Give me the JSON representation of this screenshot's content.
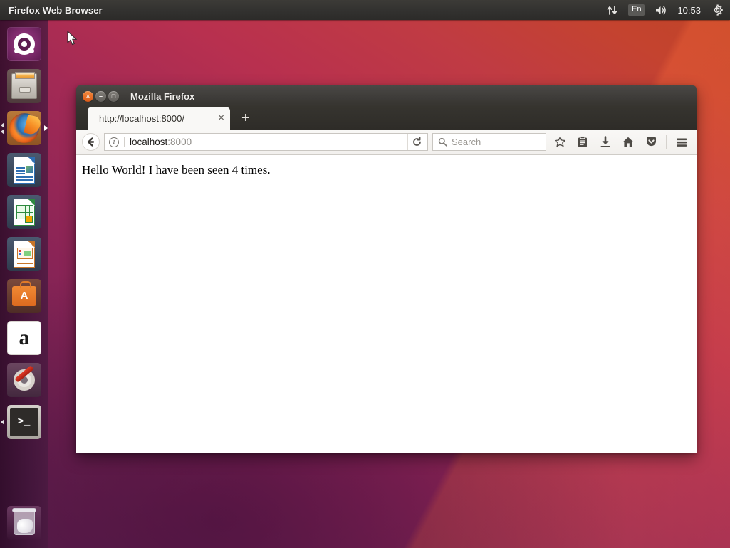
{
  "panel": {
    "title": "Firefox Web Browser",
    "indicators": {
      "network_icon": "network-transfer-icon",
      "keyboard_layout": "En",
      "volume_icon": "volume-speaker-icon",
      "clock": "10:53",
      "session_icon": "session-gear-icon"
    }
  },
  "launcher": {
    "items": [
      {
        "name": "ubuntu-dash",
        "label": "Ubuntu Dash",
        "running": false,
        "focused": false
      },
      {
        "name": "files",
        "label": "Files",
        "running": false,
        "focused": false
      },
      {
        "name": "firefox",
        "label": "Firefox Web Browser",
        "running": true,
        "focused": true
      },
      {
        "name": "libreoffice-writer",
        "label": "LibreOffice Writer",
        "running": false,
        "focused": false
      },
      {
        "name": "libreoffice-calc",
        "label": "LibreOffice Calc",
        "running": false,
        "focused": false
      },
      {
        "name": "libreoffice-impress",
        "label": "LibreOffice Impress",
        "running": false,
        "focused": false
      },
      {
        "name": "ubuntu-software",
        "label": "Ubuntu Software",
        "running": false,
        "focused": false
      },
      {
        "name": "amazon",
        "label": "Amazon",
        "running": false,
        "focused": false
      },
      {
        "name": "system-settings",
        "label": "System Settings",
        "running": false,
        "focused": false
      },
      {
        "name": "terminal",
        "label": "Terminal",
        "running": true,
        "focused": false
      }
    ],
    "trash_label": "Trash",
    "software_badge": "A",
    "amazon_letter": "a",
    "terminal_prompt": ">_"
  },
  "window": {
    "title": "Mozilla Firefox",
    "controls": {
      "close": "×",
      "minimize": "–",
      "maximize": "□"
    }
  },
  "tabs": {
    "active": {
      "label": "http://localhost:8000/",
      "close_glyph": "×"
    },
    "new_tab_glyph": "+"
  },
  "toolbar": {
    "back_glyph": "←",
    "identity_glyph": "i",
    "url_host": "localhost",
    "url_port": ":8000",
    "reload_glyph": "⟳",
    "search_placeholder": "Search",
    "icons": [
      {
        "name": "bookmark-star-icon",
        "glyph": "☆"
      },
      {
        "name": "library-icon",
        "glyph": "Ὄb"
      },
      {
        "name": "downloads-icon",
        "glyph": "⬇"
      },
      {
        "name": "home-icon",
        "glyph": "⌂"
      },
      {
        "name": "pocket-icon",
        "glyph": "▼"
      },
      {
        "name": "menu-hamburger-icon",
        "glyph": "☰"
      }
    ]
  },
  "page": {
    "body_text": "Hello World! I have been seen 4 times."
  },
  "colors": {
    "panel_bg": "#35332f",
    "launcher_bg": "#3c1438",
    "titlebar_bg": "#3d3b38",
    "close_button": "#db5a18",
    "wallpaper_purple": "#5c1f4d",
    "wallpaper_orange": "#bf4426",
    "content_bg": "#ffffff"
  }
}
